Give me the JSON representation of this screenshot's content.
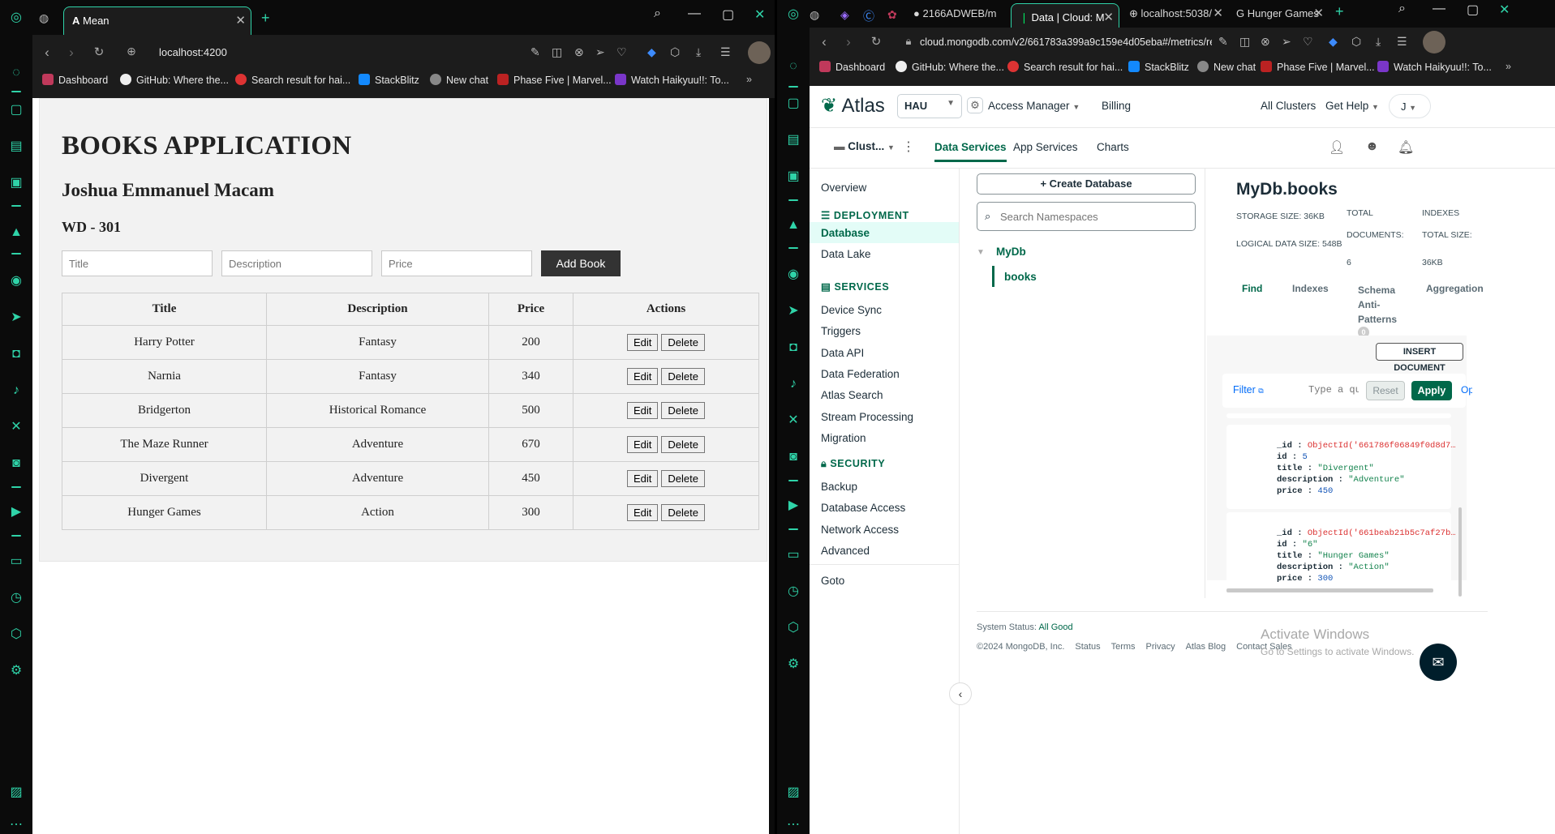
{
  "left_browser": {
    "tab_title": "Mean",
    "url": "localhost:4200",
    "bookmarks": [
      "Dashboard",
      "GitHub: Where the...",
      "Search result for hai...",
      "StackBlitz",
      "New chat",
      "Phase Five | Marvel...",
      "Watch Haikyuu!!: To..."
    ],
    "app": {
      "title": "BOOKS APPLICATION",
      "author": "Joshua Emmanuel Macam",
      "course": "WD - 301",
      "form": {
        "title_placeholder": "Title",
        "description_placeholder": "Description",
        "price_placeholder": "Price",
        "add_label": "Add Book"
      },
      "table": {
        "headers": [
          "Title",
          "Description",
          "Price",
          "Actions"
        ],
        "edit_label": "Edit",
        "delete_label": "Delete",
        "rows": [
          {
            "title": "Harry Potter",
            "description": "Fantasy",
            "price": "200"
          },
          {
            "title": "Narnia",
            "description": "Fantasy",
            "price": "340"
          },
          {
            "title": "Bridgerton",
            "description": "Historical Romance",
            "price": "500"
          },
          {
            "title": "The Maze Runner",
            "description": "Adventure",
            "price": "670"
          },
          {
            "title": "Divergent",
            "description": "Adventure",
            "price": "450"
          },
          {
            "title": "Hunger Games",
            "description": "Action",
            "price": "300"
          }
        ]
      }
    }
  },
  "right_browser": {
    "tabs": [
      "2166ADWEB/m",
      "Data | Cloud: M",
      "localhost:5038/",
      "Hunger Games"
    ],
    "url": "cloud.mongodb.com/v2/661783a399a9c159e4d05eba#/metrics/replicaSet/661",
    "bookmarks": [
      "Dashboard",
      "GitHub: Where the...",
      "Search result for hai...",
      "StackBlitz",
      "New chat",
      "Phase Five | Marvel...",
      "Watch Haikyuu!!: To..."
    ],
    "atlas": {
      "logo": "Atlas",
      "org": "HAU",
      "top_nav": [
        "Access Manager",
        "Billing",
        "All Clusters",
        "Get Help",
        "J"
      ],
      "cluster": "Clust...",
      "sub_nav": [
        "Data Services",
        "App Services",
        "Charts"
      ],
      "sidebar": {
        "overview": "Overview",
        "deployment_header": "DEPLOYMENT",
        "deployment": [
          "Database",
          "Data Lake"
        ],
        "services_header": "SERVICES",
        "services": [
          "Device Sync",
          "Triggers",
          "Data API",
          "Data Federation",
          "Atlas Search",
          "Stream Processing",
          "Migration"
        ],
        "security_header": "SECURITY",
        "security": [
          "Backup",
          "Database Access",
          "Network Access",
          "Advanced"
        ],
        "goto": "Goto"
      },
      "create_db": "Create Database",
      "search_placeholder": "Search Namespaces",
      "db_name": "MyDb",
      "collection_name": "books",
      "ns_title": "MyDb.books",
      "stats": {
        "storage": "STORAGE SIZE: 36KB",
        "logical": "LOGICAL DATA SIZE: 548B",
        "total_label": "TOTAL",
        "documents_label": "DOCUMENTS:",
        "documents": "6",
        "indexes_label": "INDEXES",
        "total_size_label": "TOTAL SIZE:",
        "index_size": "36KB"
      },
      "coll_tabs": [
        "Find",
        "Indexes",
        "Schema",
        "Anti-",
        "Patterns",
        "Aggregation"
      ],
      "anti_count": "0",
      "insert_label": "INSERT DOCUMENT",
      "filter_label": "Filter",
      "query_placeholder": "Type a que",
      "reset_label": "Reset",
      "apply_label": "Apply",
      "options_cut": "Op",
      "docs": [
        {
          "_id": "ObjectId('661786f06849f0d8d7…",
          "id": "5",
          "title": "\"Divergent\"",
          "description": "\"Adventure\"",
          "price": "450"
        },
        {
          "_id": "ObjectId('661beab21b5c7af27b…",
          "id": "\"6\"",
          "title": "\"Hunger Games\"",
          "description": "\"Action\"",
          "price": "300"
        }
      ],
      "footer": {
        "status_label": "System Status:",
        "status_value": "All Good",
        "links": [
          "©2024 MongoDB, Inc.",
          "Status",
          "Terms",
          "Privacy",
          "Atlas Blog",
          "Contact Sales"
        ]
      },
      "watermark": [
        "Activate Windows",
        "Go to Settings to activate Windows."
      ]
    }
  }
}
